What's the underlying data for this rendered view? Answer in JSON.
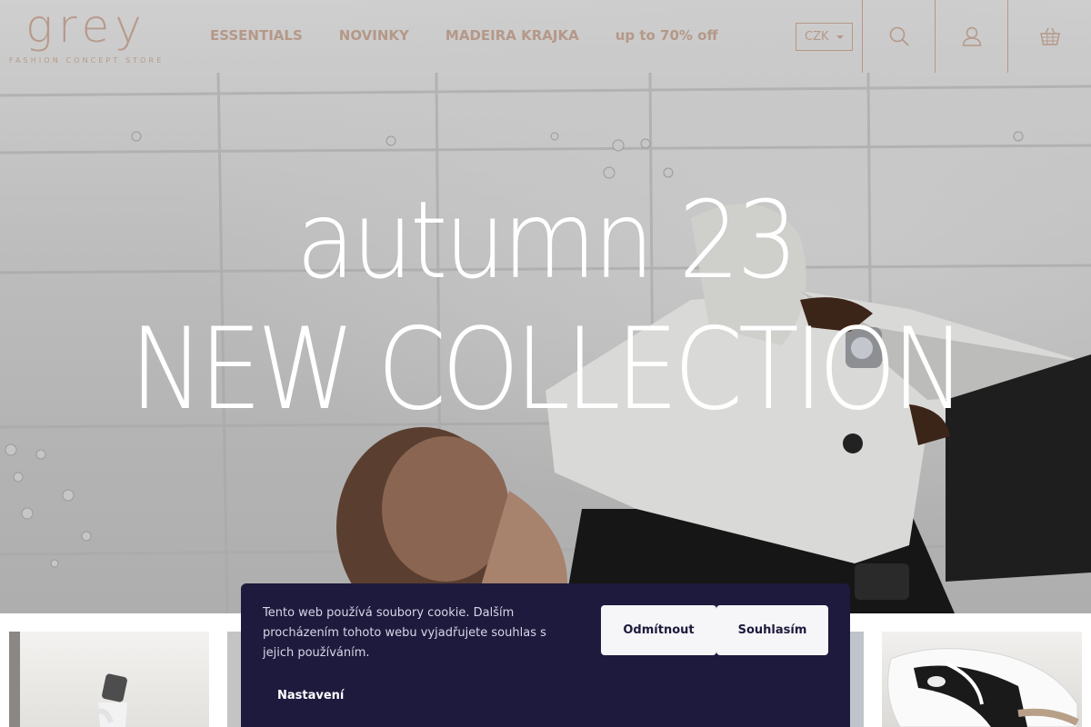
{
  "header": {
    "logo_word": "grey",
    "logo_tagline": "FASHION CONCEPT STORE",
    "nav": [
      {
        "label": "ESSENTIALS"
      },
      {
        "label": "NOVINKY"
      },
      {
        "label": "MADEIRA KRAJKA"
      },
      {
        "label": "up to 70% off"
      }
    ],
    "currency": "CZK",
    "icons": [
      "search-icon",
      "user-icon",
      "basket-icon"
    ]
  },
  "hero": {
    "line1": "autumn 23",
    "line2": "NEW COLLECTION"
  },
  "cookie_banner": {
    "text": "Tento web používá soubory cookie. Dalším procházením tohoto webu vyjadřujete souhlas s jejich používáním.",
    "decline_label": "Odmítnout",
    "accept_label": "Souhlasím",
    "settings_label": "Nastavení"
  },
  "colors": {
    "brand": "#b59888",
    "banner_bg": "#1d1a3d",
    "banner_button_bg": "#f6f6f8"
  }
}
